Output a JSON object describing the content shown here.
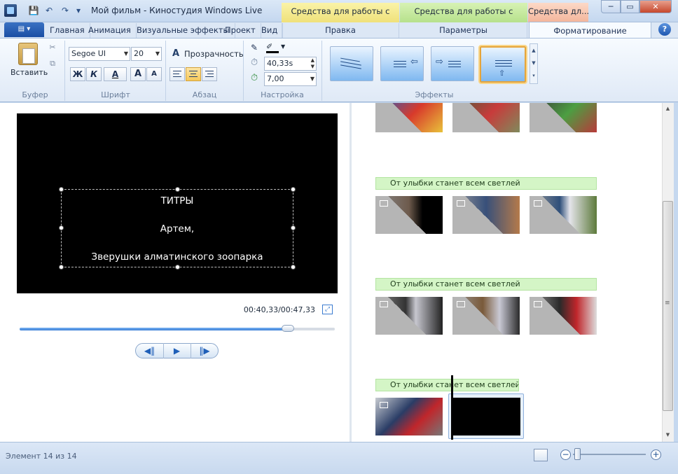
{
  "window": {
    "title": "Мой фильм - Киностудия Windows Live",
    "controls": {
      "minimize": "─",
      "maximize": "▭",
      "close": "✕"
    }
  },
  "quick_access": {
    "save_icon": "💾",
    "undo_icon": "↶",
    "redo_icon": "↷",
    "customize_icon": "▾"
  },
  "contextual_tabs": {
    "video_tools": "Средства для работы с видео",
    "music_tools": "Средства для работы с музыкой",
    "text_tools": "Средства дл..."
  },
  "tabs": {
    "app_menu": "▤ ▾",
    "home": "Главная",
    "animation": "Анимация",
    "visual_effects": "Визуальные эффекты",
    "project": "Проект",
    "view": "Вид",
    "edit": "Правка",
    "options": "Параметры",
    "format": "Форматирование",
    "help": "?"
  },
  "ribbon": {
    "clipboard": {
      "paste": "Вставить",
      "group": "Буфер",
      "cut_icon": "✂",
      "copy_icon": "⧉"
    },
    "font": {
      "family": "Segoe UI",
      "size": "20",
      "bold": "Ж",
      "italic": "К",
      "color": "A",
      "grow": "A",
      "shrink": "A",
      "group": "Шрифт"
    },
    "paragraph": {
      "transparency": "Прозрачность",
      "group": "Абзац"
    },
    "adjust": {
      "start_time": "40,33s",
      "duration": "7,00",
      "group": "Настройка"
    },
    "effects": {
      "group": "Эффекты",
      "scroll_up": "▲",
      "scroll_down": "▼",
      "more": "▾"
    }
  },
  "preview": {
    "caption": [
      "ТИТРЫ",
      "Артем,",
      "Зверушки алматинского зоопарка"
    ],
    "time": "00:40,33/00:47,33",
    "progress": 0.85,
    "prev_frame": "◀‖",
    "play": "▶",
    "next_frame": "‖▶",
    "fullscreen": "⤢"
  },
  "storyboard": {
    "music_caption": "От улыбки станет всем светлей",
    "scroll_up": "▲",
    "scroll_down": "▼",
    "scroll_grip": "≡"
  },
  "status": {
    "element": "Элемент 14 из 14",
    "zoom_out": "−",
    "zoom_in": "+"
  }
}
